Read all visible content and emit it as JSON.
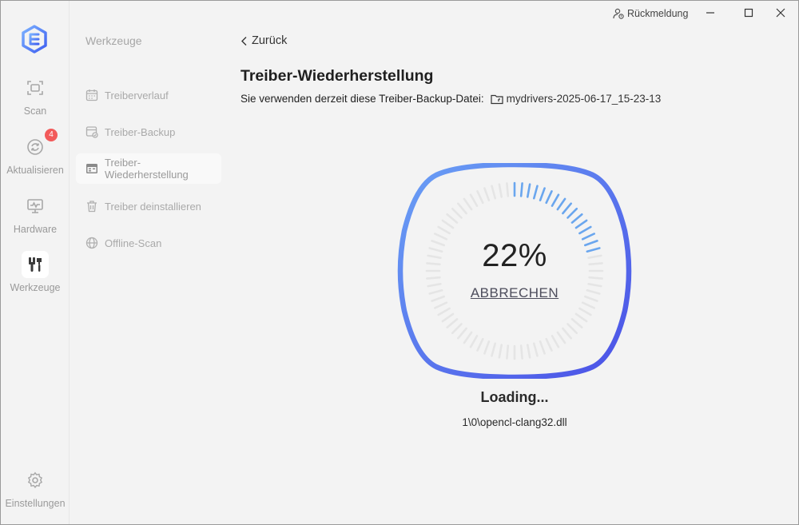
{
  "header": {
    "feedback_label": "Rückmeldung"
  },
  "sidebar": {
    "items": [
      {
        "label": "Scan",
        "icon": "scan-icon"
      },
      {
        "label": "Aktualisieren",
        "icon": "refresh-icon",
        "badge": "4"
      },
      {
        "label": "Hardware",
        "icon": "monitor-icon"
      },
      {
        "label": "Werkzeuge",
        "icon": "tools-icon",
        "active": true
      }
    ],
    "settings_label": "Einstellungen"
  },
  "tools_menu": {
    "title": "Werkzeuge",
    "items": [
      {
        "label": "Treiberverlauf",
        "icon": "calendar-icon"
      },
      {
        "label": "Treiber-Backup",
        "icon": "backup-icon"
      },
      {
        "label": "Treiber-Wiederherstellung",
        "icon": "restore-icon",
        "active": true
      },
      {
        "label": "Treiber deinstallieren",
        "icon": "trash-icon"
      },
      {
        "label": "Offline-Scan",
        "icon": "globe-icon"
      }
    ]
  },
  "main": {
    "back_label": "Zurück",
    "title": "Treiber-Wiederherstellung",
    "backup_prefix": "Sie verwenden derzeit diese Treiber-Backup-Datei:",
    "backup_file": "mydrivers-2025-06-17_15-23-13",
    "progress": {
      "percent_text": "22%",
      "value": 0.22,
      "cancel_label": "ABBRECHEN"
    },
    "status_text": "Loading...",
    "current_file": "1\\0\\opencl-clang32.dll"
  },
  "colors": {
    "gradient_start": "#6aa0f5",
    "gradient_end": "#4a50e6",
    "tick_active": "#6aa6ee",
    "tick_inactive": "#e5e5e5",
    "badge": "#f25a5a"
  }
}
